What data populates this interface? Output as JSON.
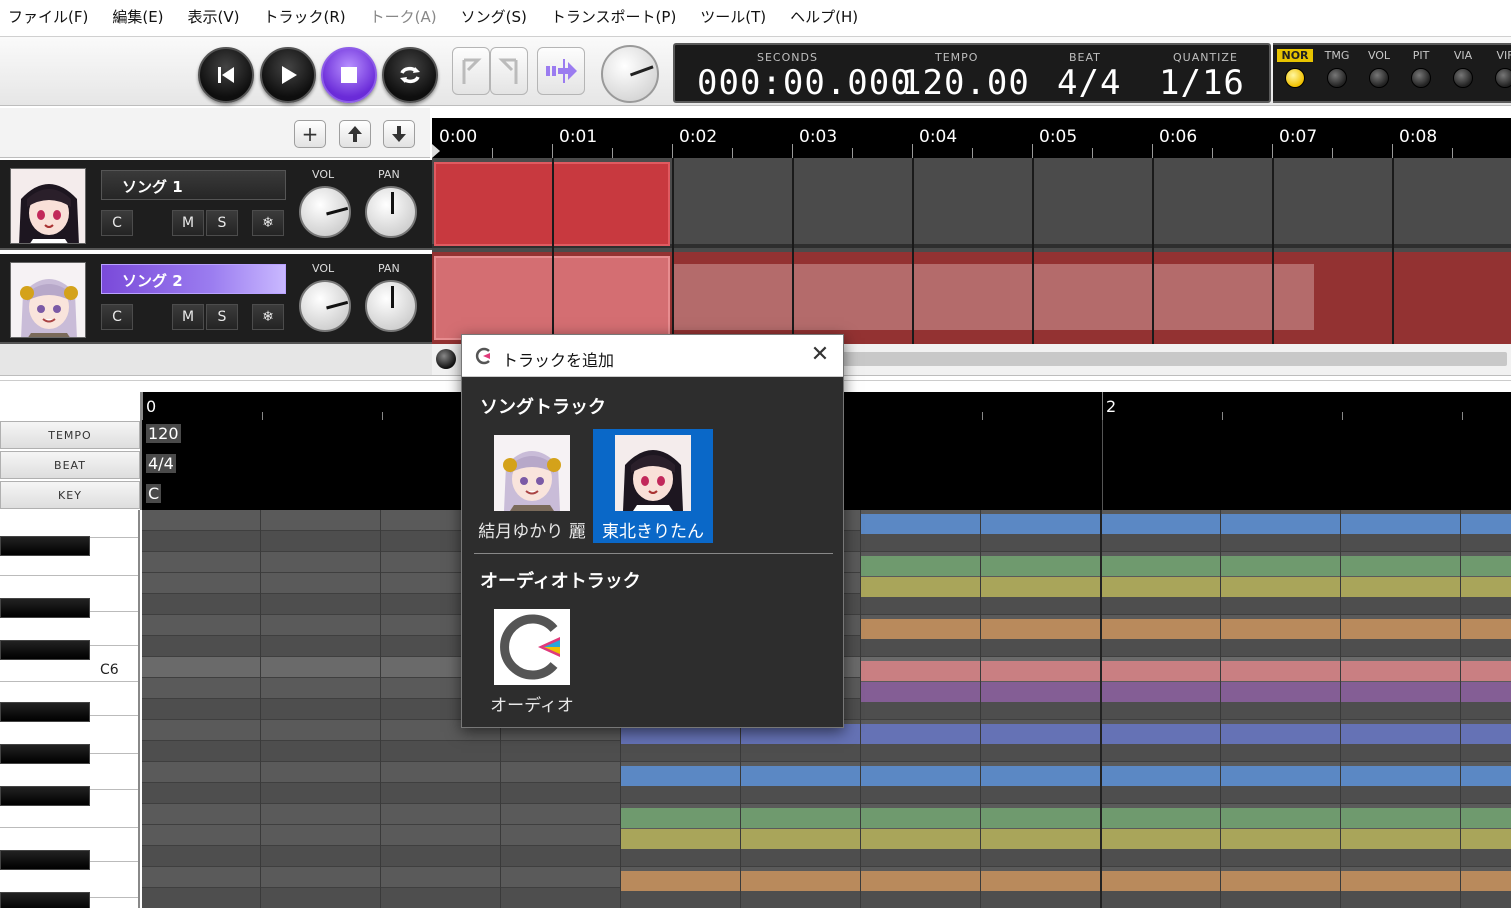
{
  "menu": [
    {
      "label": "ファイル(F)",
      "enabled": true
    },
    {
      "label": "編集(E)",
      "enabled": true
    },
    {
      "label": "表示(V)",
      "enabled": true
    },
    {
      "label": "トラック(R)",
      "enabled": true
    },
    {
      "label": "トーク(A)",
      "enabled": false
    },
    {
      "label": "ソング(S)",
      "enabled": true
    },
    {
      "label": "トランスポート(P)",
      "enabled": true
    },
    {
      "label": "ツール(T)",
      "enabled": true
    },
    {
      "label": "ヘルプ(H)",
      "enabled": true
    }
  ],
  "transport": {
    "seconds_label": "SECONDS",
    "seconds_value": "000:00.000",
    "tempo_label": "TEMPO",
    "tempo_value": "120.00",
    "beat_label": "BEAT",
    "beat_value": "4/4",
    "quantize_label": "QUANTIZE",
    "quantize_value": "1/16",
    "modes": [
      {
        "label": "NOR",
        "active": true
      },
      {
        "label": "TMG",
        "active": false
      },
      {
        "label": "VOL",
        "active": false
      },
      {
        "label": "PIT",
        "active": false
      },
      {
        "label": "VIA",
        "active": false
      },
      {
        "label": "VIF",
        "active": false
      }
    ]
  },
  "tracks": [
    {
      "name": "ソング 1",
      "selected": false,
      "vol_label": "VOL",
      "pan_label": "PAN",
      "btn_c": "C",
      "btn_m": "M",
      "btn_s": "S",
      "btn_fx": "❄"
    },
    {
      "name": "ソング 2",
      "selected": true,
      "vol_label": "VOL",
      "pan_label": "PAN",
      "btn_c": "C",
      "btn_m": "M",
      "btn_s": "S",
      "btn_fx": "❄"
    }
  ],
  "timeline": [
    "0:00",
    "0:01",
    "0:02",
    "0:03",
    "0:04",
    "0:05",
    "0:06",
    "0:07",
    "0:08"
  ],
  "editor": {
    "ruler_labels": [
      "0",
      "2"
    ],
    "tempo_label": "TEMPO",
    "tempo_value": "120",
    "beat_label": "BEAT",
    "beat_value": "4/4",
    "key_label": "KEY",
    "key_value": "C",
    "c6_label": "C6"
  },
  "dialog": {
    "title": "トラックを追加",
    "song_section": "ソングトラック",
    "voices": [
      {
        "name": "結月ゆかり 麗",
        "selected": false
      },
      {
        "name": "東北きりたん",
        "selected": true
      }
    ],
    "audio_section": "オーディオトラック",
    "audio_name": "オーディオ"
  }
}
